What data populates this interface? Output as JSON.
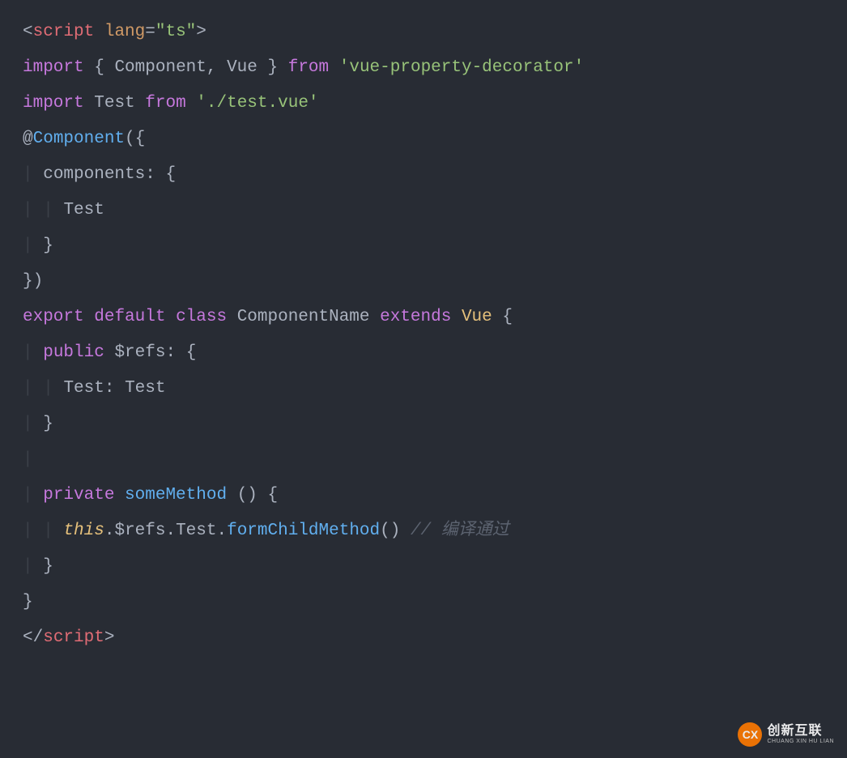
{
  "code": {
    "lines": [
      {
        "type": "open_tag",
        "tag": "script",
        "attr": "lang",
        "val": "\"ts\""
      },
      {
        "type": "blank"
      },
      {
        "type": "import1",
        "kw1": "import",
        "brace_l": "{",
        "names": "Component, Vue",
        "brace_r": "}",
        "kw2": "from",
        "str": "'vue-property-decorator'"
      },
      {
        "type": "import2",
        "kw1": "import",
        "name": "Test",
        "kw2": "from",
        "str": "'./test.vue'"
      },
      {
        "type": "blank"
      },
      {
        "type": "deco",
        "at": "@",
        "fn": "Component",
        "paren_l": "(",
        "brace_l": "{"
      },
      {
        "type": "prop",
        "indent1": "|",
        "name": "components",
        "colon": ":",
        "brace_l": "{"
      },
      {
        "type": "bare",
        "indent1": "|",
        "indent2": "|",
        "text": "Test"
      },
      {
        "type": "close_inner",
        "indent1": "|",
        "brace_r": "}"
      },
      {
        "type": "deco_close",
        "brace_r": "}",
        "paren_r": ")"
      },
      {
        "type": "classdecl",
        "kw1": "export",
        "kw2": "default",
        "kw3": "class",
        "cname": "ComponentName",
        "kw4": "extends",
        "sup": "Vue",
        "brace_l": "{"
      },
      {
        "type": "field",
        "indent1": "|",
        "mod": "public",
        "name": "$refs",
        "colon": ":",
        "brace_l": "{"
      },
      {
        "type": "typedprop",
        "indent1": "|",
        "indent2": "|",
        "name": "Test",
        "colon": ":",
        "tname": "Test"
      },
      {
        "type": "close_inner",
        "indent1": "|",
        "brace_r": "}"
      },
      {
        "type": "blank_guide",
        "indent1": "|"
      },
      {
        "type": "method",
        "indent1": "|",
        "mod": "private",
        "name": "someMethod",
        "parens": "()",
        "brace_l": "{"
      },
      {
        "type": "call",
        "indent1": "|",
        "indent2": "|",
        "this": "this",
        "chain": ".$refs.Test.",
        "fn": "formChildMethod",
        "parens": "()",
        "comment": "// 编译通过"
      },
      {
        "type": "close_inner",
        "indent1": "|",
        "brace_r": "}"
      },
      {
        "type": "close_top",
        "brace_r": "}"
      },
      {
        "type": "blank"
      },
      {
        "type": "close_tag",
        "tag": "script"
      }
    ]
  },
  "logo": {
    "cn": "创新互联",
    "en": "CHUANG XIN HU LIAN",
    "mark": "CX"
  }
}
